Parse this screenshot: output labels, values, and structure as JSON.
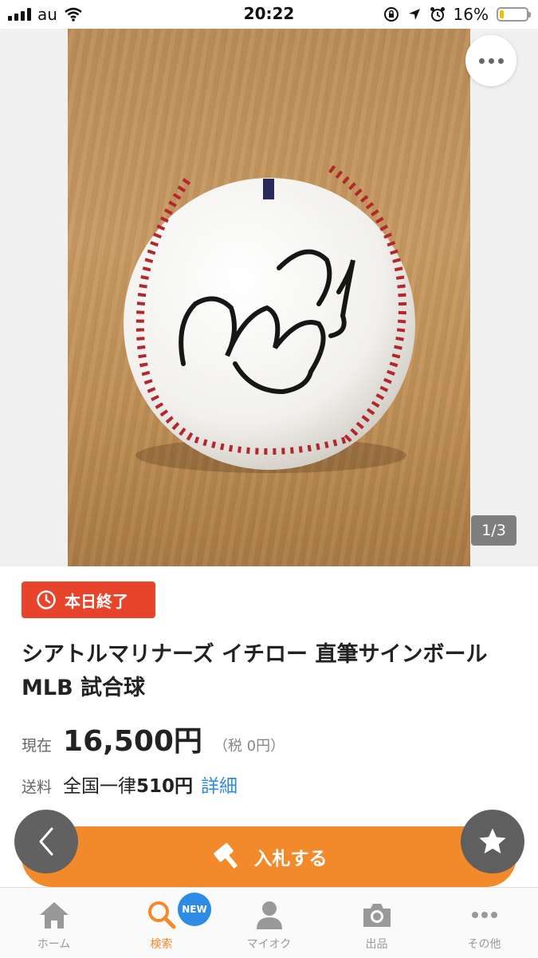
{
  "status_bar": {
    "carrier": "au",
    "time": "20:22",
    "battery_text": "16%",
    "battery_level": 0.16
  },
  "gallery": {
    "counter": "1/3"
  },
  "listing": {
    "ending_badge": "本日終了",
    "title": "シアトルマリナーズ イチロー 直筆サインボール MLB 試合球",
    "price_label": "現在",
    "price": "16,500円",
    "tax": "（税 0円）",
    "shipping_label": "送料",
    "shipping_prefix": "全国一律",
    "shipping_amount": "510円",
    "shipping_detail_link": "詳細"
  },
  "actions": {
    "bid_label": "入札する"
  },
  "tab_bar": {
    "items": [
      {
        "label": "ホーム",
        "icon": "home-icon"
      },
      {
        "label": "検索",
        "icon": "search-icon",
        "badge": "NEW"
      },
      {
        "label": "マイオク",
        "icon": "person-icon"
      },
      {
        "label": "出品",
        "icon": "camera-icon"
      },
      {
        "label": "その他",
        "icon": "more-icon"
      }
    ]
  },
  "colors": {
    "accent": "#f28a2c",
    "badge_red": "#e8432b",
    "link_blue": "#2d8be6"
  }
}
